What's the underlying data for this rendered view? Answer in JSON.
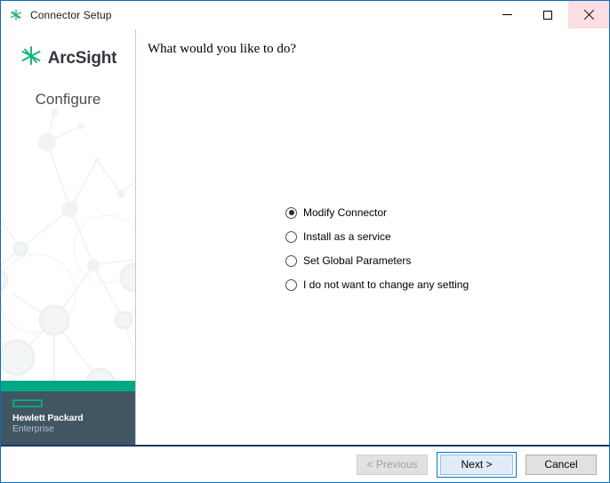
{
  "window": {
    "title": "Connector Setup",
    "icon": "arcsight-star-icon",
    "border_color": "#0a6ebd",
    "controls": {
      "minimize": "minimize-icon",
      "maximize": "maximize-icon",
      "close": "close-icon",
      "close_highlight_color": "#fbdfe2"
    }
  },
  "sidebar": {
    "brand_name": "ArcSight",
    "brand_icon": "arcsight-star-icon",
    "brand_subtitle": "Configure",
    "accent_bar_color": "#00a982",
    "footer_background": "#425563",
    "hpe": {
      "mark": "hpe-rectangle-icon",
      "mark_color": "#01a982",
      "line1": "Hewlett Packard",
      "line2": "Enterprise"
    }
  },
  "content": {
    "heading": "What would you like to do?",
    "options": [
      {
        "label": "Modify Connector",
        "checked": true
      },
      {
        "label": "Install as a service",
        "checked": false
      },
      {
        "label": "Set Global Parameters",
        "checked": false
      },
      {
        "label": "I do not want to change any setting",
        "checked": false
      }
    ]
  },
  "footer": {
    "previous_label": "< Previous",
    "previous_disabled": true,
    "next_label": "Next >",
    "next_focused": true,
    "cancel_label": "Cancel",
    "separator_color": "#1f3864",
    "focus_color": "#0078d7"
  }
}
